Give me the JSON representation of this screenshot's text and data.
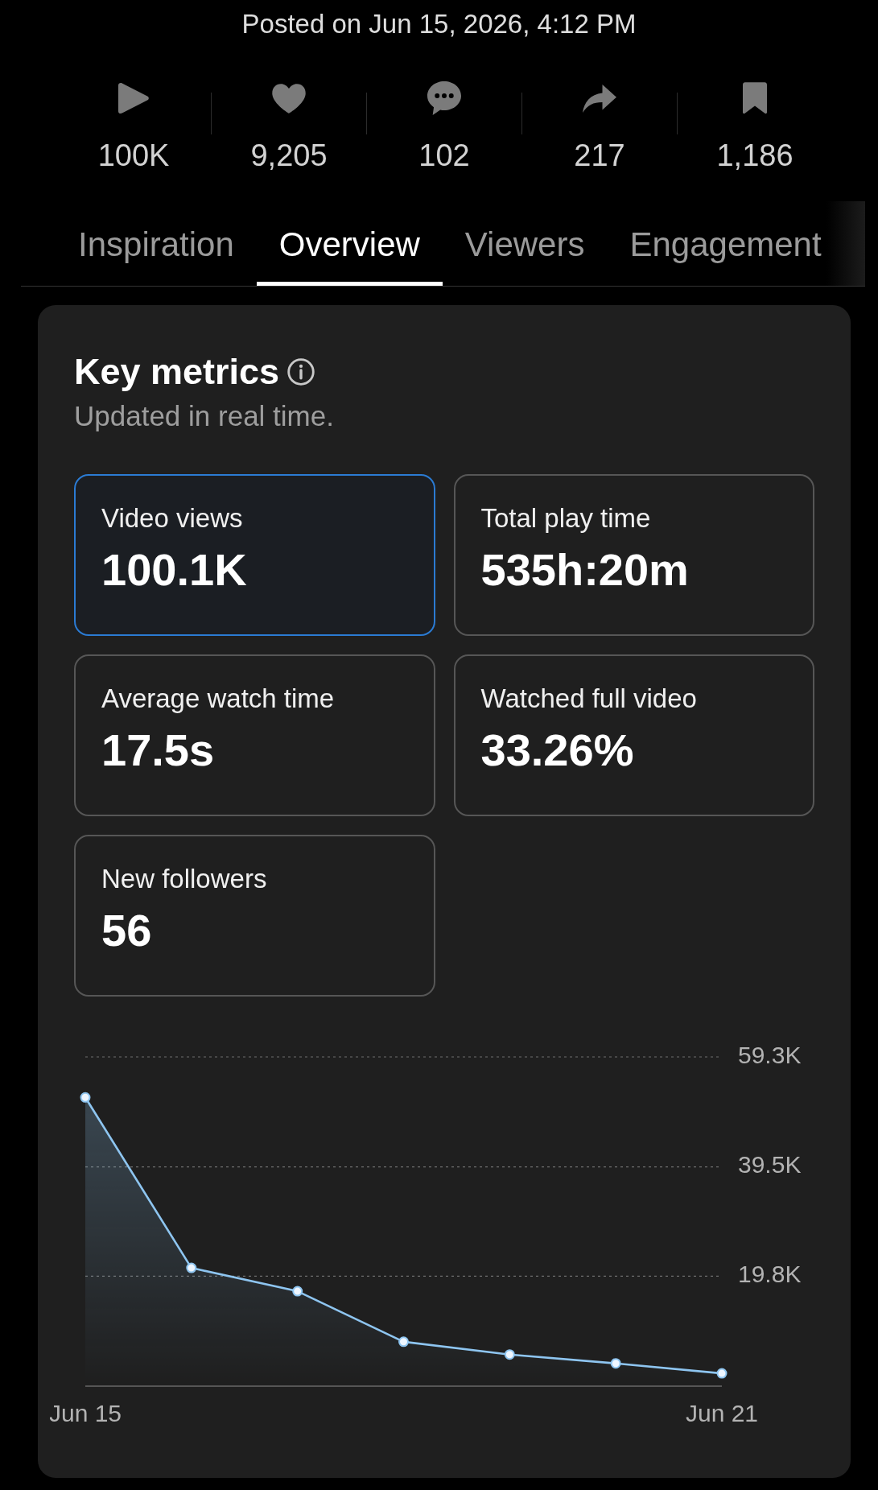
{
  "header": {
    "posted": "Posted on Jun 15, 2026, 4:12 PM"
  },
  "stats": [
    {
      "kind": "play",
      "value": "100K"
    },
    {
      "kind": "like",
      "value": "9,205"
    },
    {
      "kind": "comment",
      "value": "102"
    },
    {
      "kind": "share",
      "value": "217"
    },
    {
      "kind": "save",
      "value": "1,186"
    }
  ],
  "tabs": [
    {
      "label": "Inspiration",
      "selected": false
    },
    {
      "label": "Overview",
      "selected": true
    },
    {
      "label": "Viewers",
      "selected": false
    },
    {
      "label": "Engagement",
      "selected": false
    }
  ],
  "key_metrics": {
    "title": "Key metrics",
    "subtitle": "Updated in real time.",
    "cards": [
      {
        "label": "Video views",
        "value": "100.1K",
        "selected": true
      },
      {
        "label": "Total play time",
        "value": "535h:20m",
        "selected": false
      },
      {
        "label": "Average watch time",
        "value": "17.5s",
        "selected": false
      },
      {
        "label": "Watched full video",
        "value": "33.26%",
        "selected": false
      },
      {
        "label": "New followers",
        "value": "56",
        "selected": false
      }
    ],
    "chart_data": {
      "type": "area",
      "categories": [
        "Jun 15",
        null,
        null,
        null,
        null,
        null,
        "Jun 21"
      ],
      "series": [
        {
          "color": "#8ec5f0",
          "values": [
            52000,
            21300,
            17100,
            8000,
            5700,
            4100,
            2300
          ]
        }
      ],
      "ylim": [
        0,
        59300
      ],
      "yticks": [
        {
          "value": 19800,
          "label": "19.8K"
        },
        {
          "value": 39500,
          "label": "39.5K"
        },
        {
          "value": 59300,
          "label": "59.3K"
        }
      ]
    }
  }
}
